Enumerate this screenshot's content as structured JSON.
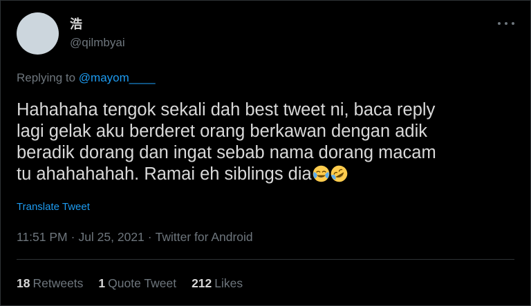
{
  "tweet": {
    "display_name": "浩",
    "handle": "@qilmbyai",
    "replying_prefix": "Replying to",
    "replying_to": "@mayom____",
    "text_lines": [
      "Hahahaha tengok sekali dah best tweet ni, baca reply",
      "lagi gelak aku berderet orang berkawan dengan adik",
      "beradik dorang dan ingat sebab nama dorang macam",
      "tu ahahahahah. Ramai eh siblings dia"
    ],
    "emojis": [
      "face-with-tears-of-joy",
      "rolling-on-the-floor-laughing"
    ],
    "translate_label": "Translate Tweet",
    "time": "11:51 PM",
    "date": "Jul 25, 2021",
    "client": "Twitter for Android",
    "separator": "·"
  },
  "stats": {
    "retweets_count": "18",
    "retweets_label": "Retweets",
    "quote_count": "1",
    "quote_label": "Quote Tweet",
    "likes_count": "212",
    "likes_label": "Likes"
  },
  "colors": {
    "background": "#000000",
    "text": "#d9d9d9",
    "secondary": "#6e767d",
    "link": "#1d9bf0",
    "border": "#2f3336"
  }
}
